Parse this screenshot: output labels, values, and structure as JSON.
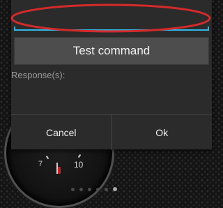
{
  "gauge": {
    "tick_left": "7",
    "tick_right": "10"
  },
  "dialog": {
    "test_button_label": "Test command",
    "response_label": "Response(s):",
    "cancel_label": "Cancel",
    "ok_label": "Ok"
  },
  "pager": {
    "dot_count": 6,
    "active_index": 5
  },
  "colors": {
    "accent": "#31b6e7",
    "highlight": "#d42a2a",
    "dialog_bg": "#2b2b2b",
    "button_bg": "#4d4d4d"
  }
}
